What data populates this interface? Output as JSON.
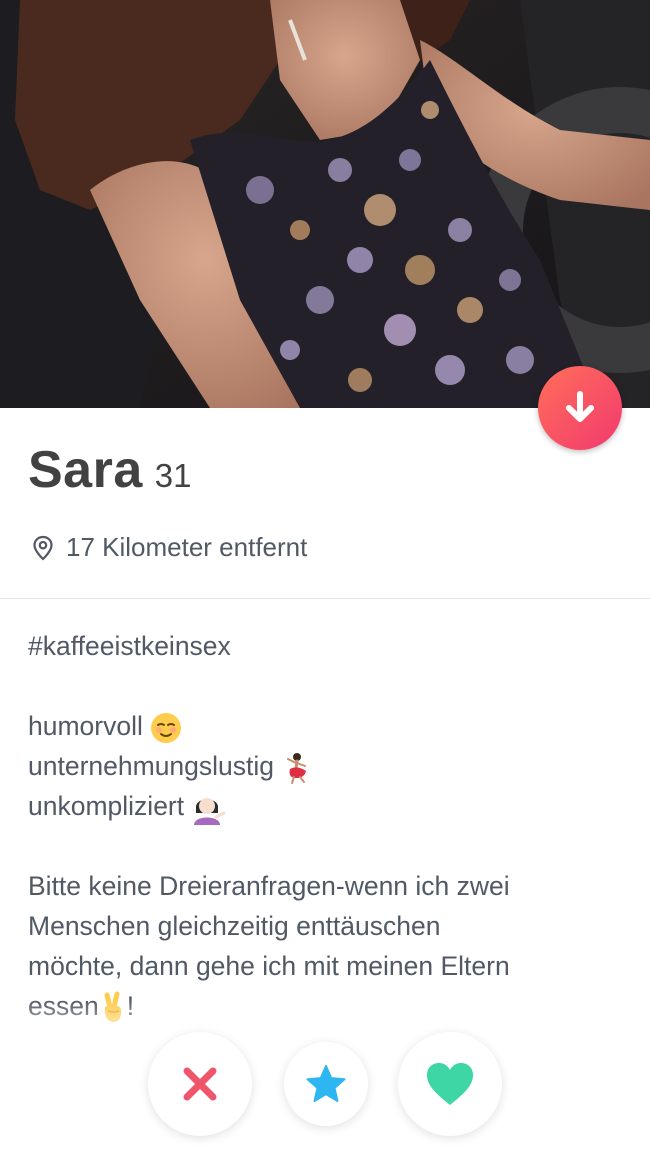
{
  "profile": {
    "name": "Sara",
    "age": "31",
    "distance": "17 Kilometer entfernt",
    "bio": {
      "hashtag": "#kaffeeistkeinsex",
      "traits": [
        {
          "text": "humorvoll",
          "emoji_icon": "relieved-face-icon"
        },
        {
          "text": "unternehmungslustig",
          "emoji_icon": "dancer-icon"
        },
        {
          "text": "unkompliziert",
          "emoji_icon": "information-desk-person-icon"
        }
      ],
      "paragraph_lines": [
        "Bitte keine Dreieranfragen-wenn ich zwei",
        "Menschen gleichzeitig enttäuschen",
        "möchte, dann gehe ich mit meinen Eltern"
      ],
      "paragraph_last": "essen",
      "paragraph_end": "!",
      "paragraph_emoji_icon": "victory-hand-icon"
    }
  },
  "icons": {
    "collapse": "arrow-down-icon",
    "location": "location-pin-icon",
    "nope": "x-icon",
    "superlike": "star-icon",
    "like": "heart-icon"
  },
  "colors": {
    "nope": "#f0566b",
    "superlike": "#2db6f1",
    "like": "#3ed6a4",
    "collapse_gradient_start": "#ff6e59",
    "collapse_gradient_end": "#f23a6f"
  }
}
